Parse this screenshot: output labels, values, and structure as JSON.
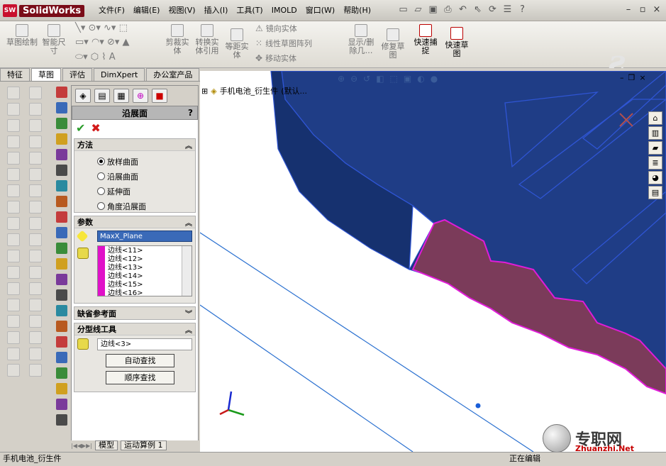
{
  "app": {
    "logo_text": "SolidWorks",
    "logo_badge": "SW"
  },
  "menu": [
    "文件(F)",
    "编辑(E)",
    "视图(V)",
    "插入(I)",
    "工具(T)",
    "IMOLD",
    "窗口(W)",
    "帮助(H)"
  ],
  "ribbon": {
    "sketch": "草图绘制",
    "smart_dim": "智能尺寸",
    "trim": "剪裁实体",
    "convert": "转换实体引用",
    "offset": "等距实体",
    "mirror": "镜向实体",
    "linear_pattern": "线性草图阵列",
    "move": "移动实体",
    "show_delete": "显示/删除几…",
    "repair": "修复草图",
    "quick_snap": "快速捕捉",
    "quick_sketch": "快速草图"
  },
  "tabs": [
    "特征",
    "草图",
    "评估",
    "DimXpert",
    "办公室产品"
  ],
  "active_tab": "草图",
  "panel": {
    "title": "沿展面",
    "help": "?",
    "method": {
      "header": "方法",
      "options": [
        "放样曲面",
        "沿展曲面",
        "延伸面",
        "角度沿展面"
      ],
      "selected": 0
    },
    "params": {
      "header": "参数",
      "plane": "MaxX_Plane",
      "edges": [
        "边线<11>",
        "边线<12>",
        "边线<13>",
        "边线<14>",
        "边线<15>",
        "边线<16>"
      ]
    },
    "default_ref": {
      "header": "缺省参考面"
    },
    "parting": {
      "header": "分型线工具",
      "edge": "边线<3>",
      "auto": "自动查找",
      "sequence": "顺序查找"
    }
  },
  "panel_bottom_tabs": [
    "模型",
    "运动算例 1"
  ],
  "tree": {
    "item": "手机电池_衍生件",
    "config": "(默认..."
  },
  "status": {
    "left": "手机电池_衍生件",
    "right": "正在编辑"
  },
  "watermark": {
    "cn": "专职网",
    "en": "Zhuanzhi.Net"
  },
  "colors": {
    "part_face": "#1f3d86",
    "part_edge": "#2f55d3",
    "tab_face": "#7b3b5a",
    "highlight": "#e01cd8"
  }
}
